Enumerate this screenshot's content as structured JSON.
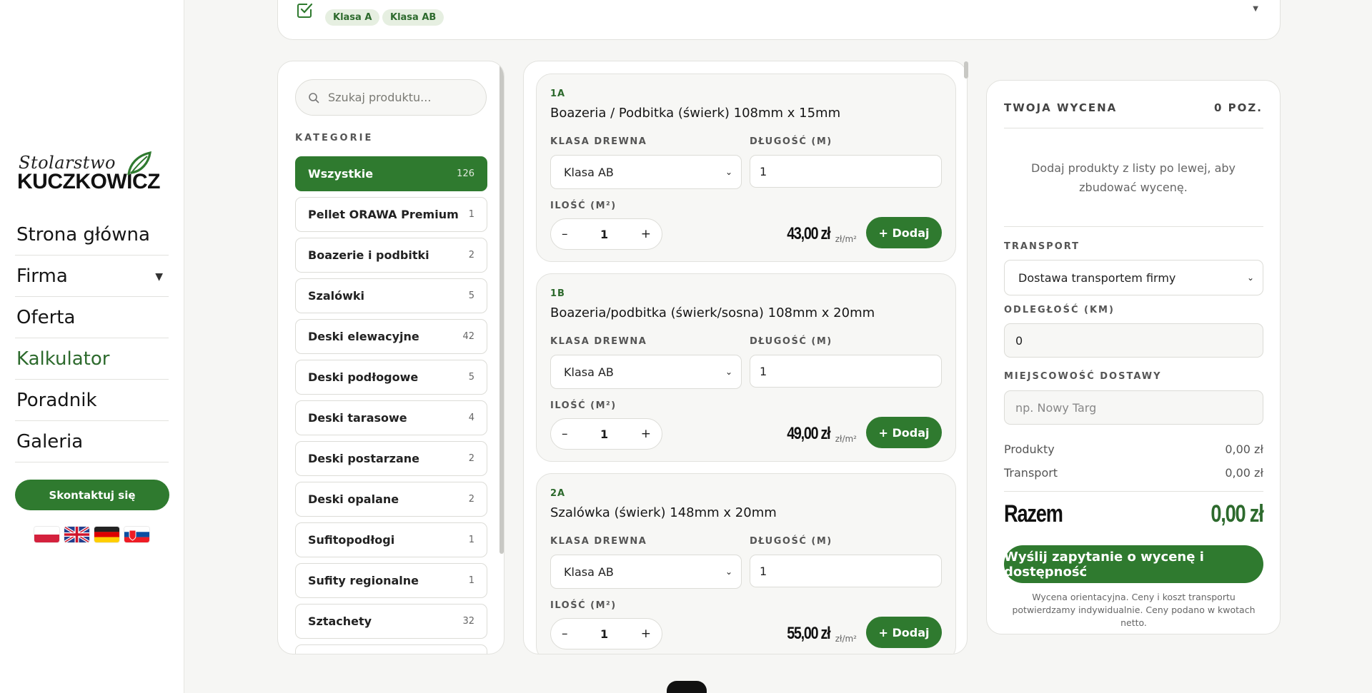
{
  "sidebar": {
    "logo_line1": "Stolarstwo",
    "logo_line2": "KUCZKOWICZ",
    "nav": [
      {
        "label": "Strona główna"
      },
      {
        "label": "Firma"
      },
      {
        "label": "Oferta"
      },
      {
        "label": "Kalkulator"
      },
      {
        "label": "Poradnik"
      },
      {
        "label": "Galeria"
      }
    ],
    "contact_label": "Skontaktuj się",
    "flags": [
      "pl-flag-icon",
      "gb-flag-icon",
      "de-flag-icon",
      "sk-flag-icon"
    ]
  },
  "top_filter": {
    "chips": [
      "Klasa A",
      "Klasa AB"
    ]
  },
  "categories": {
    "search_placeholder": "Szukaj produktu...",
    "heading": "KATEGORIE",
    "items": [
      {
        "label": "Wszystkie",
        "count": "126"
      },
      {
        "label": "Pellet ORAWA Premium",
        "count": "1"
      },
      {
        "label": "Boazerie i podbitki",
        "count": "2"
      },
      {
        "label": "Szalówki",
        "count": "5"
      },
      {
        "label": "Deski elewacyjne",
        "count": "42"
      },
      {
        "label": "Deski podłogowe",
        "count": "5"
      },
      {
        "label": "Deski tarasowe",
        "count": "4"
      },
      {
        "label": "Deski postarzane",
        "count": "2"
      },
      {
        "label": "Deski opalane",
        "count": "2"
      },
      {
        "label": "Sufitopodłogi",
        "count": "1"
      },
      {
        "label": "Sufity regionalne",
        "count": "1"
      },
      {
        "label": "Sztachety",
        "count": "32"
      }
    ]
  },
  "products": {
    "labels": {
      "wood_class": "KLASA DREWNA",
      "length": "DŁUGOŚĆ (M)",
      "quantity": "ILOŚĆ (M²)",
      "add": "+ Dodaj",
      "unit": "zł/m²"
    },
    "items": [
      {
        "code": "1A",
        "name": "Boazeria / Podbitka (świerk) 108mm x 15mm",
        "wood_class": "Klasa AB",
        "length": "1",
        "quantity": "1",
        "price": "43,00 zł"
      },
      {
        "code": "1B",
        "name": "Boazeria/podbitka (świerk/sosna) 108mm x 20mm",
        "wood_class": "Klasa AB",
        "length": "1",
        "quantity": "1",
        "price": "49,00 zł"
      },
      {
        "code": "2A",
        "name": "Szalówka (świerk) 148mm x 20mm",
        "wood_class": "Klasa AB",
        "length": "1",
        "quantity": "1",
        "price": "55,00 zł"
      }
    ]
  },
  "quote": {
    "title": "TWOJA WYCENA",
    "count": "0 POZ.",
    "empty_text": "Dodaj produkty z listy po lewej, aby zbudować wycenę.",
    "transport_label": "TRANSPORT",
    "transport_value": "Dostawa transportem firmy",
    "distance_label": "ODLEGŁOŚĆ (KM)",
    "distance_value": "0",
    "city_label": "MIEJSCOWOŚĆ DOSTAWY",
    "city_placeholder": "np. Nowy Targ",
    "products_label": "Produkty",
    "products_value": "0,00 zł",
    "transport_cost_label": "Transport",
    "transport_cost_value": "0,00 zł",
    "total_label": "Razem",
    "total_value": "0,00 zł",
    "send_label": "Wyślij zapytanie o wycenę i dostępność",
    "note": "Wycena orientacyjna. Ceny i koszt transportu potwierdzamy indywidualnie. Ceny podano w kwotach netto."
  },
  "colors": {
    "accent": "#2f7a2f",
    "accent_text": "#2d6a2d",
    "chip_bg": "#e6efe1"
  }
}
